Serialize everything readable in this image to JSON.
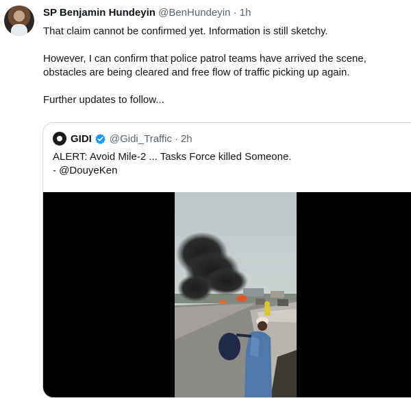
{
  "tweet": {
    "display_name": "SP Benjamin Hundeyin",
    "handle": "@BenHundeyin",
    "time": "1h",
    "paragraphs": [
      "That claim cannot be confirmed yet. Information is still sketchy.",
      "However, I can confirm that police patrol teams have arrived the scene, obstacles are being cleared and free flow of traffic picking up again.",
      "Further updates to follow..."
    ]
  },
  "quoted": {
    "display_name": "GIDI",
    "handle": "@Gidi_Traffic",
    "time": "2h",
    "text_lines": [
      "ALERT: Avoid Mile-2 ... Tasks Force killed Someone.",
      "- @DouyeKen"
    ],
    "verified_color": "#1d9bf0"
  },
  "separator": "·",
  "colors": {
    "text": "#0f1419",
    "muted": "#536471",
    "border": "#cfd9de"
  }
}
